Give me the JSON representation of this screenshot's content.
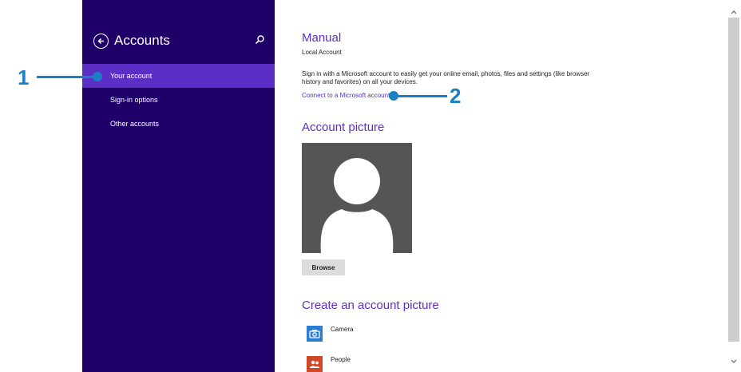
{
  "sidebar": {
    "title": "Accounts",
    "back_icon": "back-arrow-circle-icon",
    "search_icon": "search-icon",
    "items": [
      {
        "label": "Your account",
        "selected": true
      },
      {
        "label": "Sign-in options",
        "selected": false
      },
      {
        "label": "Other accounts",
        "selected": false
      }
    ],
    "bg_color": "#1f0068",
    "selected_color": "#5b2ec6"
  },
  "account": {
    "name": "Manual",
    "type": "Local Account",
    "description": "Sign in with a Microsoft account to easily get your online email, photos, files and settings (like browser history and favorites) on all your devices.",
    "connect_link": "Connect to a Microsoft account"
  },
  "picture": {
    "title": "Account picture",
    "browse_label": "Browse"
  },
  "create": {
    "title": "Create an account picture",
    "tools": [
      {
        "label": "Camera",
        "icon": "camera-icon",
        "color": "#2b7cd3"
      },
      {
        "label": "People",
        "icon": "people-icon",
        "color": "#d24726"
      }
    ]
  },
  "callouts": [
    {
      "label": "1"
    },
    {
      "label": "2"
    }
  ],
  "accent_color": "#5a30c8",
  "callout_color": "#1a7fc4"
}
